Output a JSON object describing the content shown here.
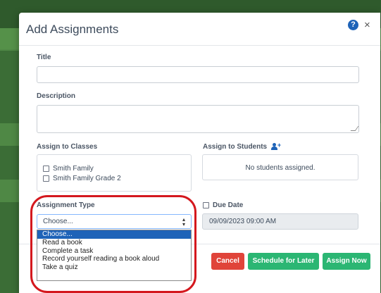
{
  "modal": {
    "title": "Add Assignments",
    "help_icon": "?",
    "close_icon": "×"
  },
  "form": {
    "title_label": "Title",
    "title_value": "",
    "description_label": "Description",
    "description_value": "",
    "assign_classes_label": "Assign to Classes",
    "classes": [
      {
        "label": "Smith Family",
        "checked": false
      },
      {
        "label": "Smith Family Grade 2",
        "checked": false
      }
    ],
    "assign_students_label": "Assign to Students",
    "no_students_text": "No students assigned.",
    "assignment_type_label": "Assignment Type",
    "assignment_type_value": "Choose...",
    "assignment_type_options": [
      "Choose...",
      "Read a book",
      "Complete a task",
      "Record yourself reading a book aloud",
      "Take a quiz"
    ],
    "due_date_label": "Due Date",
    "due_date_checked": false,
    "due_date_value": "09/09/2023 09:00 AM"
  },
  "buttons": {
    "cancel": "Cancel",
    "schedule": "Schedule for Later",
    "assign": "Assign Now"
  },
  "colors": {
    "primary": "#1e63b8",
    "success": "#2bb673",
    "danger": "#e0443a",
    "highlight": "#d4181e"
  }
}
